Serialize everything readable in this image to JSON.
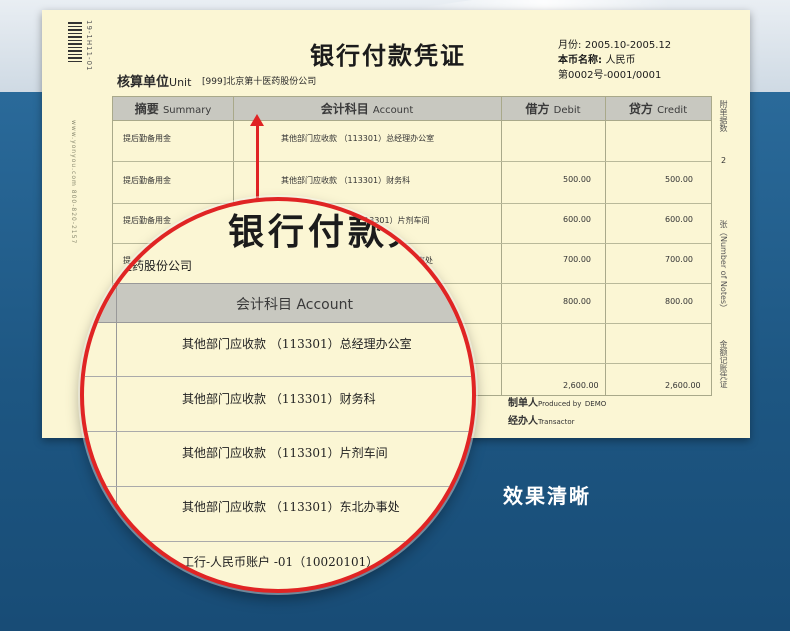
{
  "voucher": {
    "title": "银行付款凭证",
    "serial": "19-1H11-01",
    "side_text": "www.yonyou.com 800-820-2157",
    "unit_label_cn": "核算单位",
    "unit_label_en": "Unit",
    "unit_value": "[999]北京第十医药股份公司",
    "period_label": "月份:",
    "period_value": "2005.10-2005.12",
    "currency_label": "本币名称:",
    "currency_value": "人民币",
    "number_value": "第0002号-0001/0001",
    "headers": {
      "summary_cn": "摘要",
      "summary_en": "Summary",
      "account_cn": "会计科目",
      "account_en": "Account",
      "debit_cn": "借方",
      "debit_en": "Debit",
      "credit_cn": "贷方",
      "credit_en": "Credit"
    },
    "rows": [
      {
        "summary": "提后勤备用金",
        "account": "其他部门应收款  （113301）总经理办公室",
        "debit": "",
        "credit": ""
      },
      {
        "summary": "提后勤备用金",
        "account": "其他部门应收款  （113301）财务科",
        "debit": "500.00",
        "credit": "500.00"
      },
      {
        "summary": "提后勤备用金",
        "account": "",
        "debit": "600.00",
        "credit": "600.00"
      },
      {
        "summary": "",
        "account": "",
        "debit": "700.00",
        "credit": "700.00"
      },
      {
        "summary": "",
        "account": "",
        "debit": "800.00",
        "credit": "800.00"
      }
    ],
    "partial_accounts": {
      "row3": "113301）片剂车间",
      "row4": "办事处",
      "row4_summary": "提"
    },
    "total_debit": "2,600.00",
    "total_credit": "2,600.00",
    "right_side": {
      "attach_label": "附单据数",
      "attach_count": "2",
      "notes_label": "张（Number of Notes）",
      "bookkeeping": "金额记账凭证"
    },
    "maker_label": "制单人",
    "maker_en": "Produced by",
    "maker_value": "DEMO",
    "handler_label": "经办人",
    "handler_en": "Transactor"
  },
  "magnifier": {
    "title": "银行付款凭",
    "unit": "十医药股份公司",
    "unit_prefix": "第",
    "header_cn": "会计科目",
    "header_en": "Account",
    "rows": [
      "其他部门应收款   （113301）总经理办公室",
      "其他部门应收款   （113301）财务科",
      "其他部门应收款  （113301）片剂车间",
      "其他部门应收款  （113301）东北办事处",
      "工行-人民币账户 -01（10020101）"
    ]
  },
  "caption": "效果清晰",
  "colors": {
    "paper": "#fbf6d4",
    "header_gray": "#c8c8c0",
    "accent_red": "#e02424",
    "background_blue": "#1f5a88"
  }
}
